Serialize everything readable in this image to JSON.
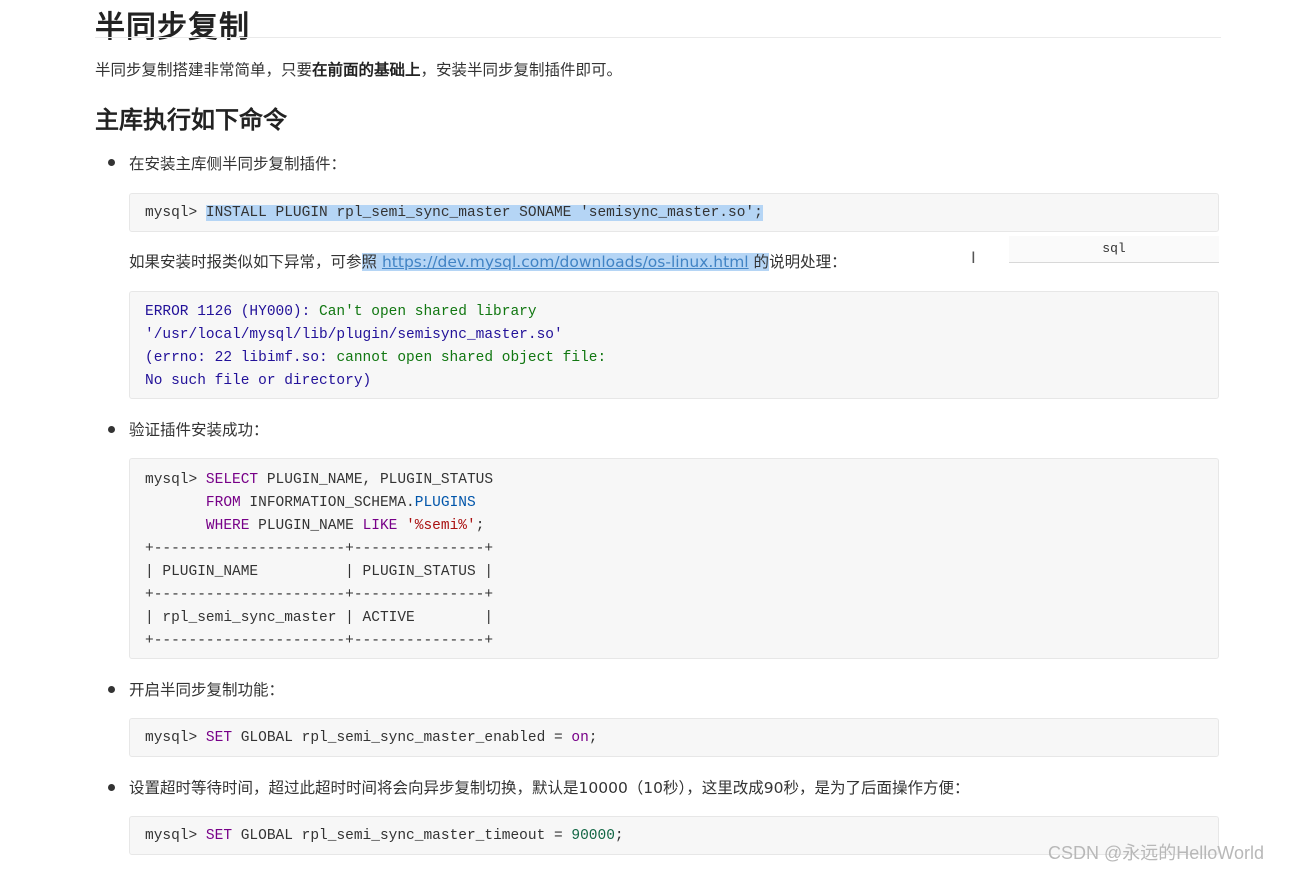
{
  "heading": "半同步复制",
  "intro": {
    "before": "半同步复制搭建非常简单，只要",
    "bold": "在前面的基础上",
    "after": "，安装半同步复制插件即可。"
  },
  "subheading": "主库执行如下命令",
  "items": [
    {
      "label": "在安装主库侧半同步复制插件："
    },
    {
      "label": "验证插件安装成功："
    },
    {
      "label": "开启半同步复制功能："
    },
    {
      "label": "设置超时等待时间，超过此超时时间将会向异步复制切换，默认是10000（10秒），这里改成90秒，是为了后面操作方便："
    }
  ],
  "install_cmd": {
    "prompt": "mysql> ",
    "command": "INSTALL PLUGIN rpl_semi_sync_master SONAME 'semisync_master.so';"
  },
  "lang_badge": "sql",
  "note": {
    "before": "如果安装时报类似如下异常，可参",
    "hl": "照",
    "link": "https://dev.mysql.com/downloads/os-linux.html",
    "hl2": " 的",
    "after": "说明处理："
  },
  "error_block": {
    "l1_a": "ERROR 1126 (HY000): ",
    "l1_b": "Can't open shared library",
    "l2": "'/usr/local/mysql/lib/plugin/semisync_master.so'",
    "l3_a": "(errno: 22 libimf.so: ",
    "l3_b": "cannot open shared object file:",
    "l4": "No such file or directory)"
  },
  "verify_block": {
    "prompt": "mysql> ",
    "select_kw": "SELECT",
    "select_rest": " PLUGIN_NAME, PLUGIN_STATUS",
    "indent": "       ",
    "from_kw": "FROM",
    "from_rest": " INFORMATION_SCHEMA.",
    "plugins": "PLUGINS",
    "where_kw": "WHERE",
    "where_mid": " PLUGIN_NAME ",
    "like_kw": "LIKE",
    "like_val": "'%semi%'",
    "semicolon": ";",
    "border": "+----------------------+---------------+",
    "header": "| PLUGIN_NAME          | PLUGIN_STATUS |",
    "row": "| rpl_semi_sync_master | ACTIVE        |"
  },
  "enable_cmd": {
    "prompt": "mysql> ",
    "set_kw": "SET",
    "rest": " GLOBAL rpl_semi_sync_master_enabled = ",
    "val": "on",
    "end": ";"
  },
  "timeout_cmd": {
    "prompt": "mysql> ",
    "set_kw": "SET",
    "rest": " GLOBAL rpl_semi_sync_master_timeout = ",
    "val": "90000",
    "end": ";"
  },
  "watermark": "CSDN @永远的HelloWorld",
  "cursor_glyph": "I"
}
